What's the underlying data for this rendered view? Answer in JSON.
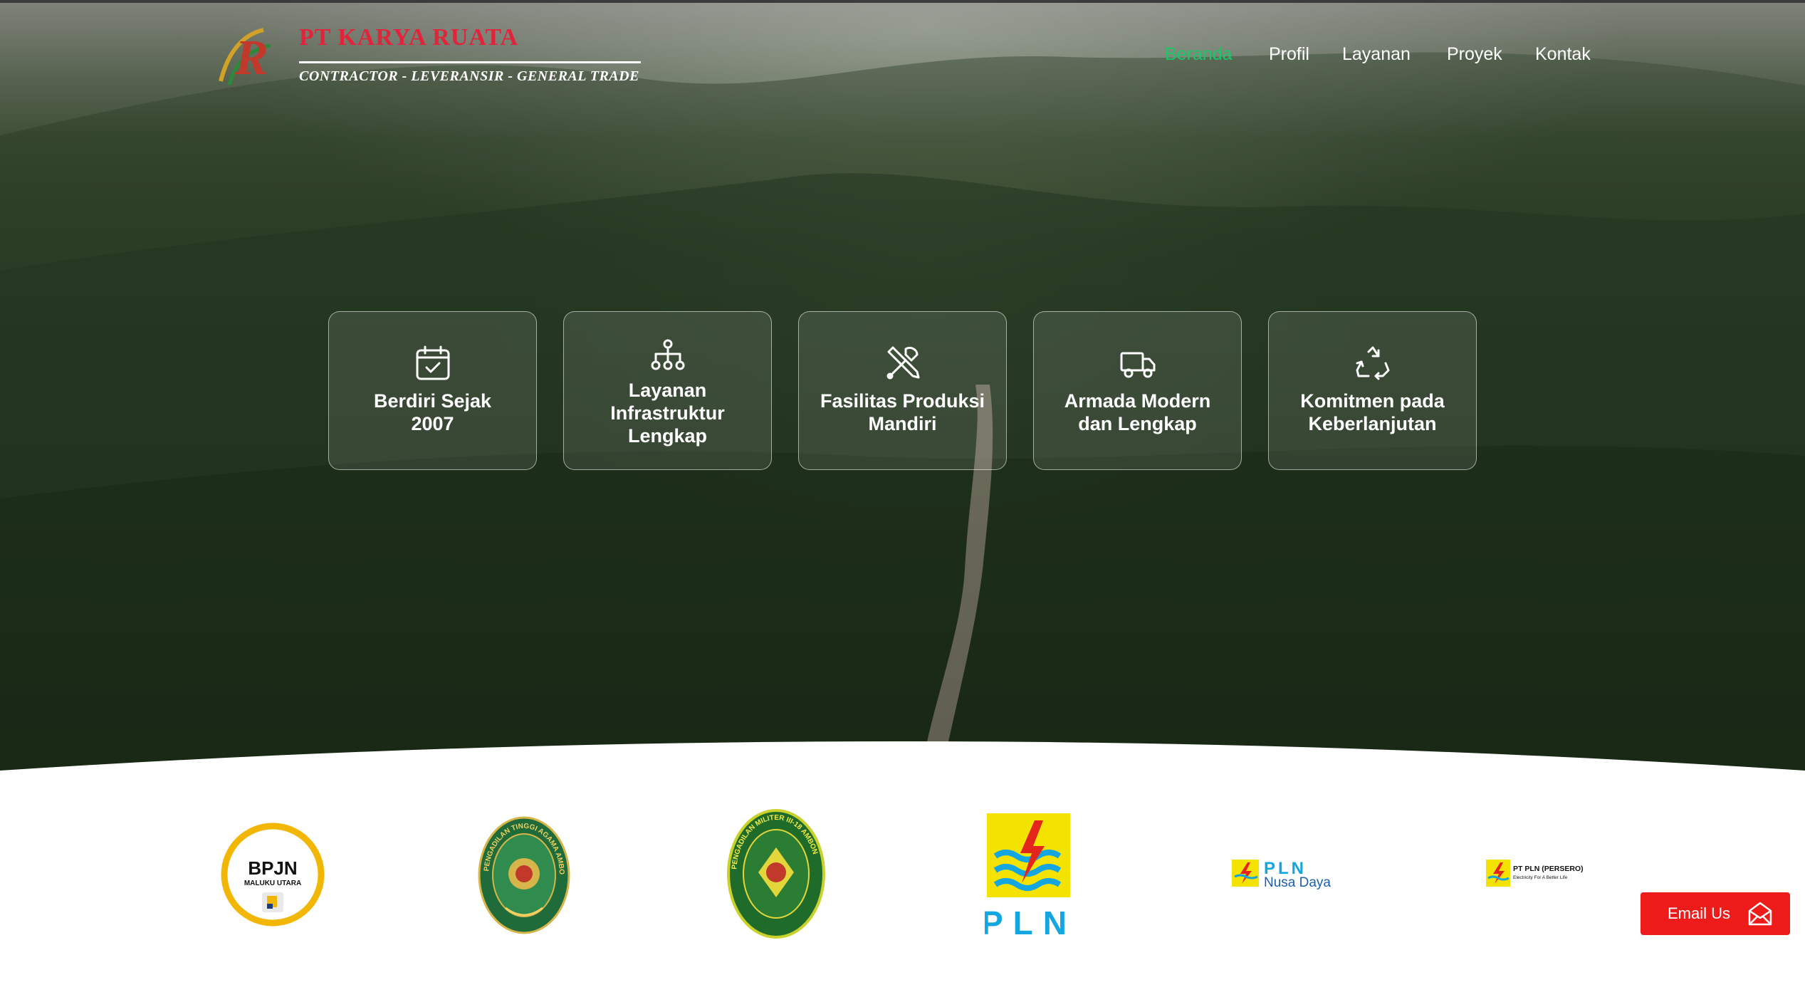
{
  "brand": {
    "name": "PT KARYA RUATA",
    "tagline": "CONTRACTOR - LEVERANSIR - GENERAL TRADE",
    "mark_letter": "R"
  },
  "nav": {
    "items": [
      {
        "label": "Beranda",
        "active": true
      },
      {
        "label": "Profil",
        "active": false
      },
      {
        "label": "Layanan",
        "active": false
      },
      {
        "label": "Proyek",
        "active": false
      },
      {
        "label": "Kontak",
        "active": false
      }
    ]
  },
  "features": [
    {
      "label": "Berdiri Sejak 2007",
      "lines": [
        "Berdiri Sejak",
        "2007"
      ],
      "icon": "calendar-check-icon"
    },
    {
      "label": "Layanan Infrastruktur Lengkap",
      "lines": [
        "Layanan",
        "Infrastruktur",
        "Lengkap"
      ],
      "icon": "sitemap-icon"
    },
    {
      "label": "Fasilitas Produksi Mandiri",
      "lines": [
        "Fasilitas Produksi",
        "Mandiri"
      ],
      "icon": "tools-icon"
    },
    {
      "label": "Armada Modern dan Lengkap",
      "lines": [
        "Armada Modern",
        "dan Lengkap"
      ],
      "icon": "truck-icon"
    },
    {
      "label": "Komitmen pada Keberlanjutan",
      "lines": [
        "Komitmen pada",
        "Keberlanjutan"
      ],
      "icon": "recycle-icon"
    }
  ],
  "partners": {
    "bpjn": {
      "title": "BPJN",
      "subtitle": "MALUKU UTARA"
    },
    "pta": {
      "ring_text": "PENGADILAN TINGGI AGAMA AMBON"
    },
    "dilmil": {
      "ring_text": "PENGADILAN MILITER III-18 AMBON"
    },
    "pln": {
      "text": "PLN"
    },
    "pln_nusa_daya": {
      "title": "PLN",
      "subtitle": "Nusa Daya"
    },
    "pln_persero": {
      "title": "PT PLN (PERSERO)",
      "subtitle": "Electricity For A Better Life"
    }
  },
  "contact": {
    "email_label": "Email Us",
    "icon": "envelope-icon"
  },
  "colors": {
    "accent_green": "#1cc768",
    "brand_red": "#e2243b",
    "button_red": "#ee1b1b",
    "pln_yellow": "#f4e200",
    "pln_blue": "#13a6e0"
  }
}
